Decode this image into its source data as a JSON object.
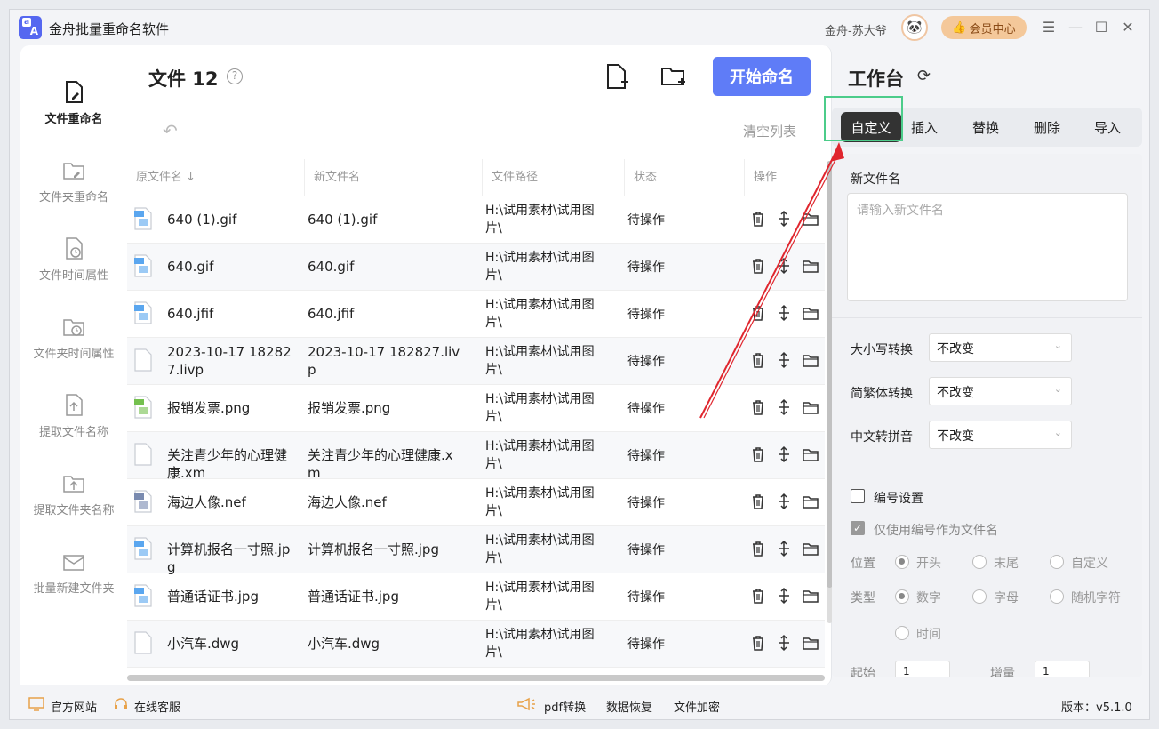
{
  "app": {
    "title": "金舟批量重命名软件",
    "user": "金舟-苏大爷",
    "vip": "会员中心"
  },
  "nav": [
    {
      "label": "文件重命名",
      "icon": "file-edit-icon",
      "active": true
    },
    {
      "label": "文件夹重命名",
      "icon": "folder-edit-icon"
    },
    {
      "label": "文件时间属性",
      "icon": "file-clock-icon"
    },
    {
      "label": "文件夹时间属性",
      "icon": "folder-clock-icon"
    },
    {
      "label": "提取文件名称",
      "icon": "file-upload-icon"
    },
    {
      "label": "提取文件夹名称",
      "icon": "folder-upload-icon"
    },
    {
      "label": "批量新建文件夹",
      "icon": "mail-folder-icon"
    }
  ],
  "main": {
    "files_label": "文件 12",
    "start_button": "开始命名",
    "clear_list": "清空列表",
    "columns": {
      "orig": "原文件名",
      "new": "新文件名",
      "path": "文件路径",
      "status": "状态",
      "ops": "操作"
    }
  },
  "rows": [
    {
      "orig": "640 (1).gif",
      "new": "640 (1).gif",
      "path": "H:\\试用素材\\试用图片\\",
      "status": "待操作",
      "type": "gif"
    },
    {
      "orig": "640.gif",
      "new": "640.gif",
      "path": "H:\\试用素材\\试用图片\\",
      "status": "待操作",
      "type": "gif"
    },
    {
      "orig": "640.jfif",
      "new": "640.jfif",
      "path": "H:\\试用素材\\试用图片\\",
      "status": "待操作",
      "type": "jpg"
    },
    {
      "orig": "2023-10-17 182827.livp",
      "new": "2023-10-17 182827.livp",
      "path": "H:\\试用素材\\试用图片\\",
      "status": "待操作",
      "type": "blank"
    },
    {
      "orig": "报销发票.png",
      "new": "报销发票.png",
      "path": "H:\\试用素材\\试用图片\\",
      "status": "待操作",
      "type": "png"
    },
    {
      "orig": "关注青少年的心理健康.xm",
      "new": "关注青少年的心理健康.xm",
      "path": "H:\\试用素材\\试用图片\\",
      "status": "待操作",
      "type": "blank"
    },
    {
      "orig": "海边人像.nef",
      "new": "海边人像.nef",
      "path": "H:\\试用素材\\试用图片\\",
      "status": "待操作",
      "type": "nef"
    },
    {
      "orig": "计算机报名一寸照.jpg",
      "new": "计算机报名一寸照.jpg",
      "path": "H:\\试用素材\\试用图片\\",
      "status": "待操作",
      "type": "jpg"
    },
    {
      "orig": "普通话证书.jpg",
      "new": "普通话证书.jpg",
      "path": "H:\\试用素材\\试用图片\\",
      "status": "待操作",
      "type": "jpg"
    },
    {
      "orig": "小汽车.dwg",
      "new": "小汽车.dwg",
      "path": "H:\\试用素材\\试用图片\\",
      "status": "待操作",
      "type": "blank"
    }
  ],
  "workbench": {
    "title": "工作台",
    "tabs": [
      "自定义",
      "插入",
      "替换",
      "删除",
      "导入"
    ],
    "new_name_label": "新文件名",
    "new_name_placeholder": "请输入新文件名",
    "case_label": "大小写转换",
    "case_value": "不改变",
    "trad_label": "简繁体转换",
    "trad_value": "不改变",
    "pinyin_label": "中文转拼音",
    "pinyin_value": "不改变",
    "numbering_label": "编号设置",
    "only_number_label": "仅使用编号作为文件名",
    "position_label": "位置",
    "position_opts": [
      "开头",
      "末尾",
      "自定义"
    ],
    "type_label": "类型",
    "type_opts": [
      "数字",
      "字母",
      "随机字符",
      "时间"
    ],
    "start_label": "起始",
    "start_value": "1",
    "step_label": "增量",
    "step_value": "1"
  },
  "footer": {
    "website": "官方网站",
    "support": "在线客服",
    "pdf": "pdf转换",
    "recovery": "数据恢复",
    "encrypt": "文件加密",
    "version": "版本：v5.1.0"
  },
  "colors": {
    "accent": "#5f7cf7",
    "highlight": "#4ccc8a",
    "arrow": "#e0262e"
  }
}
